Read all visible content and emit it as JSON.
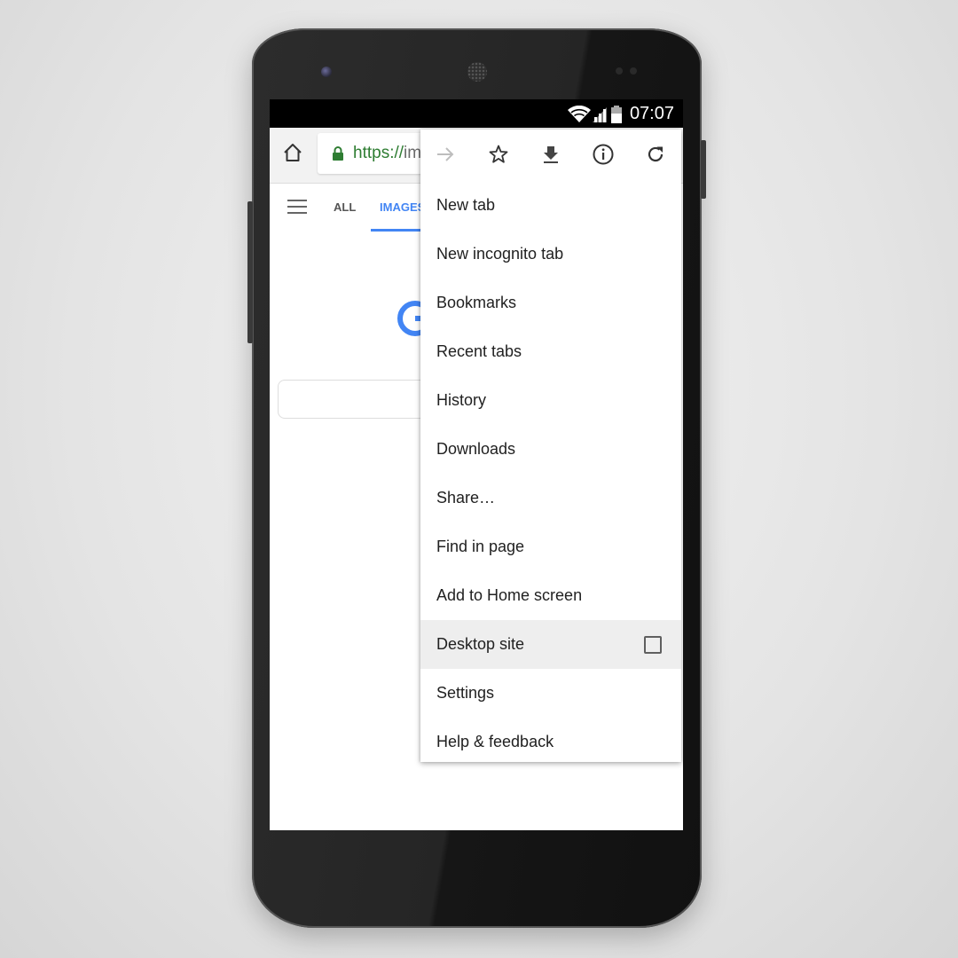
{
  "status_bar": {
    "time": "07:07",
    "icons": [
      "wifi-icon",
      "signal-icon",
      "battery-icon"
    ]
  },
  "browser": {
    "url_scheme": "https://",
    "url_rest": "im",
    "home_icon": "home-icon",
    "lock_icon": "lock-icon",
    "colors": {
      "secure": "#2e7d32",
      "accent": "#4285f4"
    }
  },
  "page": {
    "tabs": [
      {
        "label": "ALL",
        "active": false
      },
      {
        "label": "IMAGES",
        "active": true
      }
    ]
  },
  "menu": {
    "icon_row": [
      {
        "name": "forward-icon",
        "enabled": false
      },
      {
        "name": "bookmark-star-icon",
        "enabled": true
      },
      {
        "name": "download-icon",
        "enabled": true
      },
      {
        "name": "info-icon",
        "enabled": true
      },
      {
        "name": "refresh-icon",
        "enabled": true
      }
    ],
    "items": [
      {
        "label": "New tab"
      },
      {
        "label": "New incognito tab"
      },
      {
        "label": "Bookmarks"
      },
      {
        "label": "Recent tabs"
      },
      {
        "label": "History"
      },
      {
        "label": "Downloads"
      },
      {
        "label": "Share…"
      },
      {
        "label": "Find in page"
      },
      {
        "label": "Add to Home screen"
      },
      {
        "label": "Desktop site",
        "checkbox": true,
        "checked": false,
        "highlighted": true
      },
      {
        "label": "Settings"
      },
      {
        "label": "Help & feedback"
      }
    ]
  }
}
